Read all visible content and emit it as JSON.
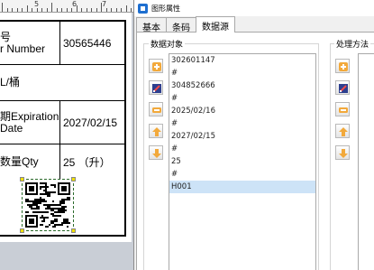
{
  "ruler": {
    "marks": [
      "5",
      "6",
      "7"
    ]
  },
  "label": {
    "rows": [
      {
        "left": "号\nr Number",
        "right": "30565446"
      },
      {
        "left": "L/桶",
        "right": ""
      },
      {
        "left": "期Expiration\nDate",
        "right": "2027/02/15"
      },
      {
        "left": "数量Qty",
        "right": "25 （升）"
      }
    ]
  },
  "dialog": {
    "title": "图形属性",
    "tabs": [
      {
        "label": "基本",
        "active": false
      },
      {
        "label": "条码",
        "active": false
      },
      {
        "label": "数据源",
        "active": true
      }
    ],
    "data_group_title": "数据对象",
    "proc_group_title": "处理方法",
    "data_buttons": [
      "add-icon",
      "edit-icon",
      "delete-icon",
      "move-up-icon",
      "move-down-icon"
    ],
    "proc_buttons": [
      "add-icon",
      "edit-icon",
      "delete-icon",
      "move-up-icon",
      "move-down-icon"
    ],
    "data_items": [
      {
        "text": "302601147",
        "selected": false
      },
      {
        "text": "#",
        "selected": false
      },
      {
        "text": "304852666",
        "selected": false
      },
      {
        "text": "#",
        "selected": false
      },
      {
        "text": "2025/02/16",
        "selected": false
      },
      {
        "text": "#",
        "selected": false
      },
      {
        "text": "2027/02/15",
        "selected": false
      },
      {
        "text": "#",
        "selected": false
      },
      {
        "text": "25",
        "selected": false
      },
      {
        "text": "#",
        "selected": false
      },
      {
        "text": "H001",
        "selected": true
      }
    ]
  },
  "colors": {
    "accent": "#1e6fd0",
    "selection": "#cde3f7",
    "handle": "#f0e000"
  }
}
